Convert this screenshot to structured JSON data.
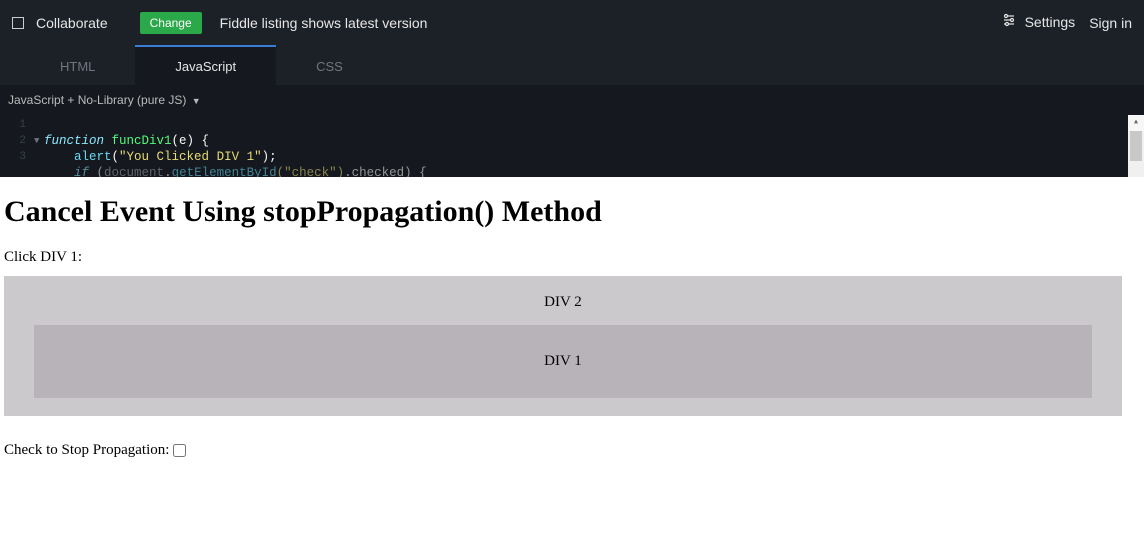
{
  "topbar": {
    "collaborate": "Collaborate",
    "change": "Change",
    "status": "Fiddle listing shows latest version",
    "settings": "Settings",
    "signin": "Sign in"
  },
  "tabs": {
    "html": "HTML",
    "javascript": "JavaScript",
    "css": "CSS"
  },
  "subbar": {
    "langmode": "JavaScript + No-Library (pure JS)"
  },
  "code": {
    "line1_num": "1",
    "line2_num": "2",
    "line2_kw": "function",
    "line2_fn": " funcDiv1",
    "line2_params": "(e)",
    "line2_brace": " {",
    "line3_num": "3",
    "line3_indent": "    ",
    "line3_fn": "alert",
    "line3_open": "(",
    "line3_str": "\"You Clicked DIV 1\"",
    "line3_close": ");",
    "line4_indent": "    ",
    "line4_kw": "if",
    "line4_open": " (",
    "line4_ident": "document",
    "line4_dot": ".",
    "line4_fn": "getElementById",
    "line4_args": "(\"check\")",
    "line4_prop": ".checked) {"
  },
  "preview": {
    "heading": "Cancel Event Using stopPropagation() Method",
    "clickLabel": "Click DIV 1:",
    "div2": "DIV 2",
    "div1": "DIV 1",
    "checkLabel": "Check to Stop Propagation:"
  }
}
